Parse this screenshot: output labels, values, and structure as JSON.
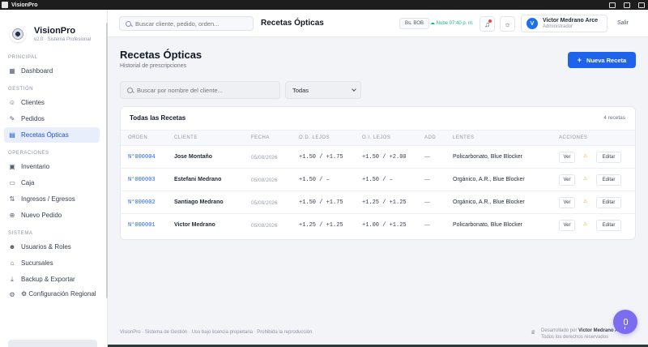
{
  "os": {
    "title": "VisionPro"
  },
  "brand": {
    "name": "VisionPro",
    "subtitle": "v2.0 · Sistema Profesional"
  },
  "sidebar": {
    "sections": [
      {
        "title": "PRINCIPAL",
        "items": [
          {
            "label": "Dashboard",
            "icon": "grid-icon"
          }
        ]
      },
      {
        "title": "GESTIÓN",
        "items": [
          {
            "label": "Clientes",
            "icon": "users-icon"
          },
          {
            "label": "Pedidos",
            "icon": "edit-icon"
          },
          {
            "label": "Recetas Ópticas",
            "icon": "document-icon",
            "active": true
          }
        ]
      },
      {
        "title": "OPERACIONES",
        "items": [
          {
            "label": "Inventario",
            "icon": "box-icon"
          },
          {
            "label": "Caja",
            "icon": "cash-icon"
          },
          {
            "label": "Ingresos / Egresos",
            "icon": "swap-icon"
          },
          {
            "label": "Nuevo Pedido",
            "icon": "plus-circle-icon"
          }
        ]
      },
      {
        "title": "SISTEMA",
        "items": [
          {
            "label": "Usuarios & Roles",
            "icon": "user-roles-icon"
          },
          {
            "label": "Sucursales",
            "icon": "building-icon"
          },
          {
            "label": "Backup & Exportar",
            "icon": "download-icon"
          },
          {
            "label": "⚙ Configuración Regional",
            "icon": "settings-icon"
          }
        ]
      }
    ]
  },
  "header": {
    "search_placeholder": "Buscar cliente, pedido, orden...",
    "title": "Recetas Ópticas",
    "currency": "Bs. BOB",
    "cloud_status": "☁ Nube 07:40 p. m.",
    "user": {
      "initial": "V",
      "name": "Victor Medrano Arce",
      "role": "Administrador"
    },
    "logout": "Salir"
  },
  "page": {
    "title": "Recetas Ópticas",
    "subtitle": "Historial de prescripciones",
    "new_button": "Nueva Receta",
    "filter_placeholder": "Buscar por nombre del cliente...",
    "filter_select": "Todas"
  },
  "table": {
    "title": "Todas las Recetas",
    "count": "4 recetas",
    "columns": [
      "ORDEN",
      "CLIENTE",
      "FECHA",
      "O.D. LEJOS",
      "O.I. LEJOS",
      "ADD",
      "LENTES",
      "ACCIONES"
    ],
    "rows": [
      {
        "order": "N°000004",
        "client": "Jose Montaño",
        "date": "05/08/2026",
        "od": "+1.50 / +1.75",
        "oi": "+1.50 / +2.00",
        "add": "—",
        "lens": "Policarbonato, Blue Blocker"
      },
      {
        "order": "N°000003",
        "client": "Estefani Medrano",
        "date": "05/08/2026",
        "od": "+1.50 / –",
        "oi": "+1.50 / –",
        "add": "—",
        "lens": "Orgánico, A.R., Blue Blocker"
      },
      {
        "order": "N°000002",
        "client": "Santiago Medrano",
        "date": "05/08/2026",
        "od": "+1.50 / +1.75",
        "oi": "+1.25 / +1.25",
        "add": "—",
        "lens": "Orgánico, A.R., Blue Blocker"
      },
      {
        "order": "N°000001",
        "client": "Victor Medrano",
        "date": "05/08/2026",
        "od": "+1.25 / +1.25",
        "oi": "+1.00 / +1.25",
        "add": "—",
        "lens": "Policarbonato, Blue Blocker"
      }
    ],
    "actions": {
      "view": "Ver",
      "warn": "⚠",
      "edit": "Editar"
    }
  },
  "footer": {
    "left": "VisionPro · Sistema de Gestión · Uso bajo licencia propietaria · Prohibida la reproducción",
    "right_prefix": "Desarrollado por",
    "right_name": "Victor Medrano Arce",
    "right_line2": "Todos los derechos reservados"
  },
  "colors": {
    "accent": "#1e63e9",
    "active_bg": "#e8eefc",
    "mic": "#7c6cf0",
    "cloud_ok": "#10b981",
    "warn": "#f59e0b"
  }
}
